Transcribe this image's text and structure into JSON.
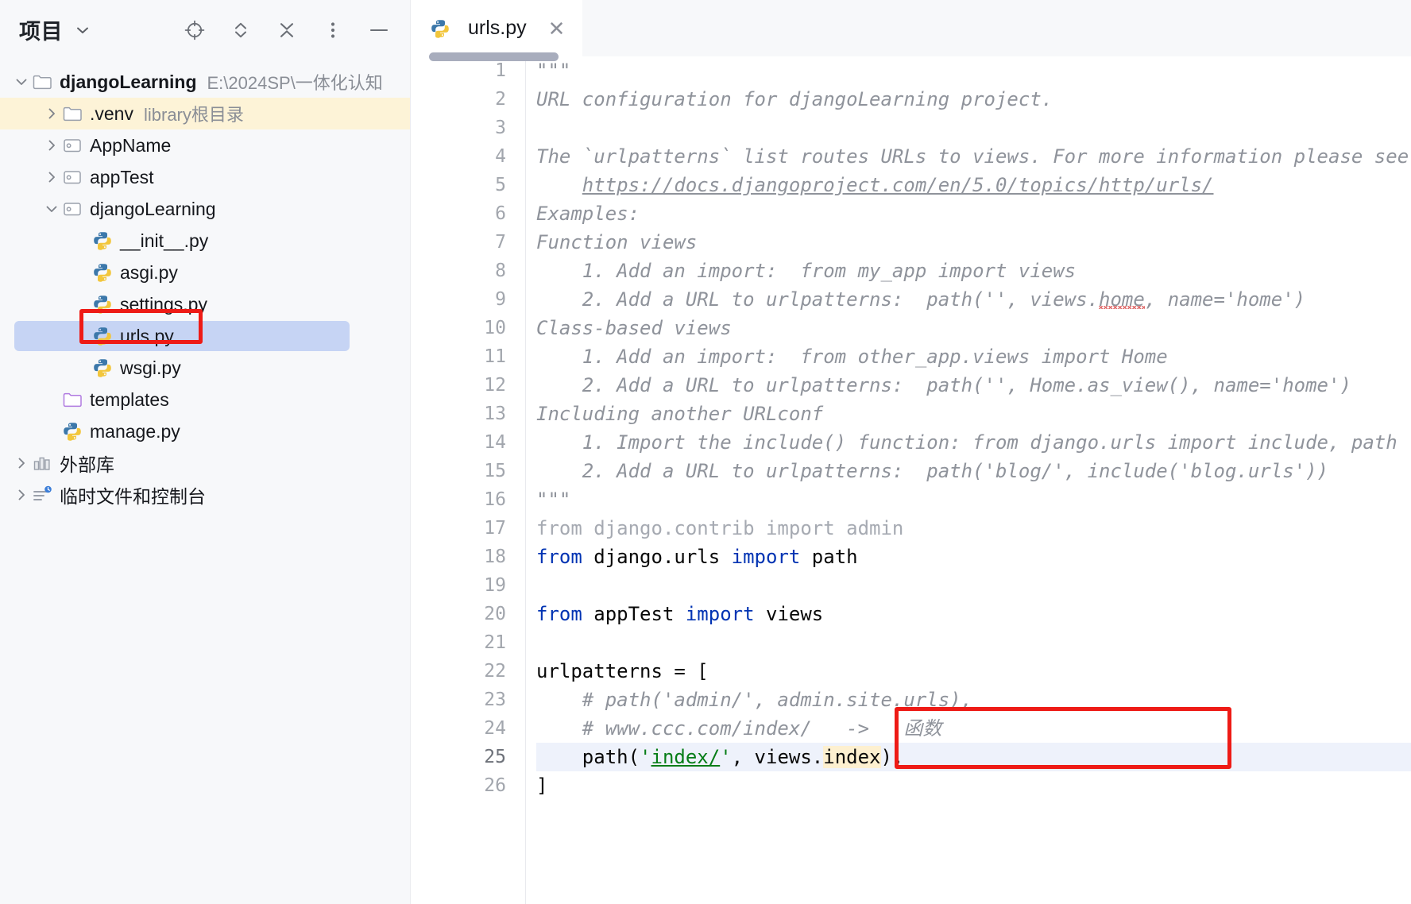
{
  "sidebar": {
    "title": "项目",
    "title_chevron_icon": "chevron-down-icon",
    "tools": [
      {
        "name": "select-opened-file-icon",
        "label": "Select Opened File"
      },
      {
        "name": "expand-all-icon",
        "label": "Expand All"
      },
      {
        "name": "collapse-all-icon",
        "label": "Collapse All"
      },
      {
        "name": "more-options-icon",
        "label": "Options"
      },
      {
        "name": "hide-panel-icon",
        "label": "Hide"
      }
    ],
    "tree": [
      {
        "label": "djangoLearning",
        "sub": "E:\\2024SP\\一体化认知",
        "icon": "folder-icon",
        "indent": 0,
        "arrow": "down",
        "bold": true,
        "state": "normal"
      },
      {
        "label": ".venv",
        "sub": "library根目录",
        "icon": "folder-icon",
        "indent": 1,
        "arrow": "right",
        "bold": false,
        "state": "venv"
      },
      {
        "label": "AppName",
        "sub": "",
        "icon": "module-folder-icon",
        "indent": 1,
        "arrow": "right",
        "bold": false,
        "state": "normal"
      },
      {
        "label": "appTest",
        "sub": "",
        "icon": "module-folder-icon",
        "indent": 1,
        "arrow": "right",
        "bold": false,
        "state": "normal"
      },
      {
        "label": "djangoLearning",
        "sub": "",
        "icon": "module-folder-icon",
        "indent": 1,
        "arrow": "down",
        "bold": false,
        "state": "normal"
      },
      {
        "label": "__init__.py",
        "sub": "",
        "icon": "python-file-icon",
        "indent": 2,
        "arrow": "none",
        "bold": false,
        "state": "normal"
      },
      {
        "label": "asgi.py",
        "sub": "",
        "icon": "python-file-icon",
        "indent": 2,
        "arrow": "none",
        "bold": false,
        "state": "normal"
      },
      {
        "label": "settings.py",
        "sub": "",
        "icon": "python-file-icon",
        "indent": 2,
        "arrow": "none",
        "bold": false,
        "state": "normal"
      },
      {
        "label": "urls.py",
        "sub": "",
        "icon": "python-file-icon",
        "indent": 2,
        "arrow": "none",
        "bold": false,
        "state": "selected"
      },
      {
        "label": "wsgi.py",
        "sub": "",
        "icon": "python-file-icon",
        "indent": 2,
        "arrow": "none",
        "bold": false,
        "state": "normal"
      },
      {
        "label": "templates",
        "sub": "",
        "icon": "templates-folder-icon",
        "indent": 1,
        "arrow": "none",
        "bold": false,
        "state": "normal"
      },
      {
        "label": "manage.py",
        "sub": "",
        "icon": "python-file-icon",
        "indent": 1,
        "arrow": "none",
        "bold": false,
        "state": "normal"
      },
      {
        "label": "外部库",
        "sub": "",
        "icon": "external-libraries-icon",
        "indent": 0,
        "arrow": "right",
        "bold": false,
        "state": "normal"
      },
      {
        "label": "临时文件和控制台",
        "sub": "",
        "icon": "scratches-icon",
        "indent": 0,
        "arrow": "right",
        "bold": false,
        "state": "normal"
      }
    ]
  },
  "editor": {
    "tab": {
      "label": "urls.py",
      "icon": "python-file-icon",
      "close_icon": "close-icon"
    },
    "lines": [
      {
        "n": "1",
        "segs": [
          {
            "t": "\"\"\"",
            "c": "doc"
          }
        ]
      },
      {
        "n": "2",
        "segs": [
          {
            "t": "URL configuration for djangoLearning project.",
            "c": "doc"
          }
        ]
      },
      {
        "n": "3",
        "segs": [
          {
            "t": "",
            "c": "doc"
          }
        ]
      },
      {
        "n": "4",
        "segs": [
          {
            "t": "The `urlpatterns` list routes URLs to views. For more information please see:",
            "c": "doc"
          }
        ]
      },
      {
        "n": "5",
        "segs": [
          {
            "t": "    ",
            "c": "doc"
          },
          {
            "t": "https://docs.djangoproject.com/en/5.0/topics/http/urls/",
            "c": "lnk"
          }
        ]
      },
      {
        "n": "6",
        "segs": [
          {
            "t": "Examples:",
            "c": "doc"
          }
        ]
      },
      {
        "n": "7",
        "segs": [
          {
            "t": "Function views",
            "c": "doc"
          }
        ]
      },
      {
        "n": "8",
        "segs": [
          {
            "t": "    1. Add an import:  from my_app import views",
            "c": "doc"
          }
        ]
      },
      {
        "n": "9",
        "segs": [
          {
            "t": "    2. Add a URL to urlpatterns:  path('', views.",
            "c": "doc"
          },
          {
            "t": "home",
            "c": "doc squig"
          },
          {
            "t": ", name='home')",
            "c": "doc"
          }
        ]
      },
      {
        "n": "10",
        "segs": [
          {
            "t": "Class-based views",
            "c": "doc"
          }
        ]
      },
      {
        "n": "11",
        "segs": [
          {
            "t": "    1. Add an import:  from other_app.views import Home",
            "c": "doc"
          }
        ]
      },
      {
        "n": "12",
        "segs": [
          {
            "t": "    2. Add a URL to urlpatterns:  path('', Home.as_view(), name='home')",
            "c": "doc"
          }
        ]
      },
      {
        "n": "13",
        "segs": [
          {
            "t": "Including another URLconf",
            "c": "doc"
          }
        ]
      },
      {
        "n": "14",
        "segs": [
          {
            "t": "    1. Import the include() function: from django.urls import include, path",
            "c": "doc"
          }
        ]
      },
      {
        "n": "15",
        "segs": [
          {
            "t": "    2. Add a URL to urlpatterns:  path('blog/', include('blog.urls'))",
            "c": "doc"
          }
        ]
      },
      {
        "n": "16",
        "segs": [
          {
            "t": "\"\"\"",
            "c": "doc"
          }
        ]
      },
      {
        "n": "17",
        "segs": [
          {
            "t": "from django.contrib import admin",
            "c": "grayed"
          }
        ]
      },
      {
        "n": "18",
        "segs": [
          {
            "t": "from",
            "c": "kw"
          },
          {
            "t": " django.urls ",
            "c": "txt"
          },
          {
            "t": "import",
            "c": "kw"
          },
          {
            "t": " path",
            "c": "txt"
          }
        ]
      },
      {
        "n": "19",
        "segs": [
          {
            "t": "",
            "c": "txt"
          }
        ]
      },
      {
        "n": "20",
        "segs": [
          {
            "t": "from",
            "c": "kw"
          },
          {
            "t": " appTest ",
            "c": "txt"
          },
          {
            "t": "import",
            "c": "kw"
          },
          {
            "t": " views",
            "c": "txt"
          }
        ]
      },
      {
        "n": "21",
        "segs": [
          {
            "t": "",
            "c": "txt"
          }
        ]
      },
      {
        "n": "22",
        "segs": [
          {
            "t": "urlpatterns = [",
            "c": "txt"
          }
        ]
      },
      {
        "n": "23",
        "segs": [
          {
            "t": "    # path('admin/', admin.site.urls),",
            "c": "com"
          }
        ]
      },
      {
        "n": "24",
        "segs": [
          {
            "t": "    # www.ccc.com/index/   ->   函数",
            "c": "com"
          }
        ],
        "bulb": true
      },
      {
        "n": "25",
        "segs": [
          {
            "t": "    path(",
            "c": "txt"
          },
          {
            "t": "'",
            "c": "str"
          },
          {
            "t": "index/",
            "c": "str-u"
          },
          {
            "t": "'",
            "c": "str"
          },
          {
            "t": ", views.",
            "c": "txt"
          },
          {
            "t": "index",
            "c": "txt hl-ident"
          },
          {
            "t": "),",
            "c": "txt"
          }
        ],
        "current": true
      },
      {
        "n": "26",
        "segs": [
          {
            "t": "]",
            "c": "txt"
          }
        ]
      }
    ]
  },
  "annotations": {
    "sidebar_box": {
      "target": "urls.py",
      "color": "#ee1b16"
    },
    "code_box": {
      "target": "lines 24-25",
      "color": "#ee1b16"
    }
  }
}
